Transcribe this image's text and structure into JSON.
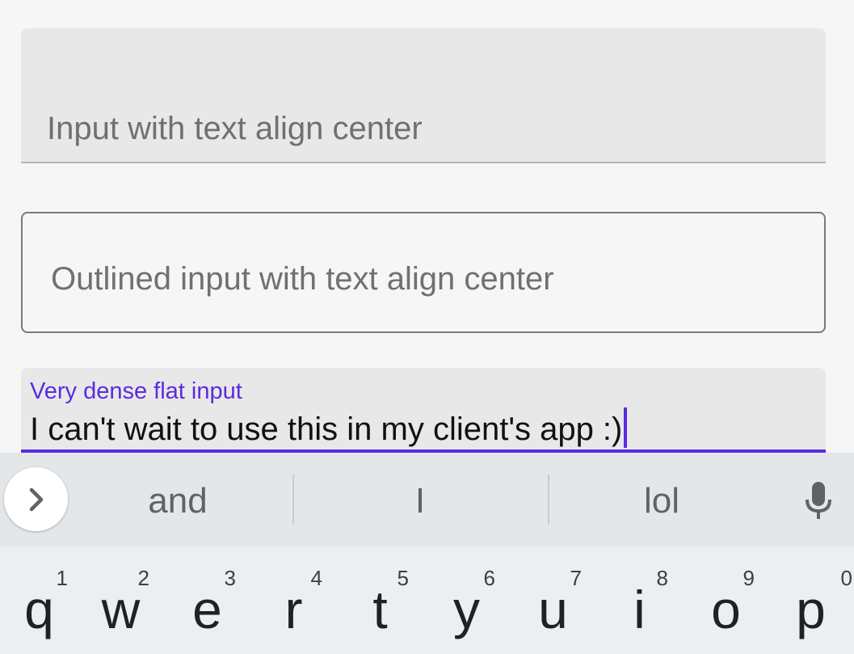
{
  "inputs": {
    "flat": {
      "placeholder": "Input with text align center"
    },
    "outlined": {
      "placeholder": "Outlined input with text align center"
    },
    "dense": {
      "label": "Very dense flat input",
      "value": "I can't wait to use this in my client's app :)"
    }
  },
  "keyboard": {
    "expand_icon": "chevron-right-icon",
    "suggestions": [
      "and",
      "I",
      "lol"
    ],
    "mic_icon": "microphone-icon",
    "keys": [
      {
        "num": "1",
        "ch": "q"
      },
      {
        "num": "2",
        "ch": "w"
      },
      {
        "num": "3",
        "ch": "e"
      },
      {
        "num": "4",
        "ch": "r"
      },
      {
        "num": "5",
        "ch": "t"
      },
      {
        "num": "6",
        "ch": "y"
      },
      {
        "num": "7",
        "ch": "u"
      },
      {
        "num": "8",
        "ch": "i"
      },
      {
        "num": "9",
        "ch": "o"
      },
      {
        "num": "0",
        "ch": "p"
      }
    ]
  },
  "colors": {
    "accent": "#5b2be0",
    "field_bg": "#e8e8e8",
    "page_bg": "#f6f6f6",
    "keyboard_bg": "#eceff1"
  }
}
